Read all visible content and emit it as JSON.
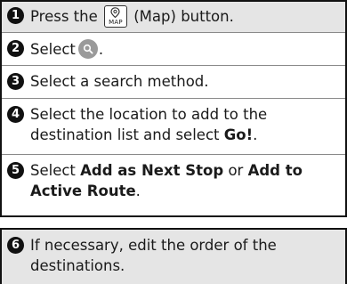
{
  "steps": [
    {
      "num": "1",
      "pre": "Press the",
      "button_caption": "MAP",
      "post": "(Map) button."
    },
    {
      "num": "2",
      "pre": "Select",
      "post": "."
    },
    {
      "num": "3",
      "text": "Select a search method."
    },
    {
      "num": "4",
      "line1": "Select the location to add to the",
      "line2_pre": "destination list and select",
      "line2_bold": "Go!",
      "line2_post": "."
    },
    {
      "num": "5",
      "pre": "Select",
      "bold1": "Add as Next Stop",
      "mid": "or",
      "bold2": "Add to",
      "line2_bold": "Active Route",
      "line2_post": "."
    },
    {
      "num": "6",
      "line1": "If necessary, edit the order of the",
      "line2": "destinations."
    }
  ],
  "icons": {
    "map_button": "map-pin-icon",
    "search_button": "search-magnifier-icon"
  }
}
